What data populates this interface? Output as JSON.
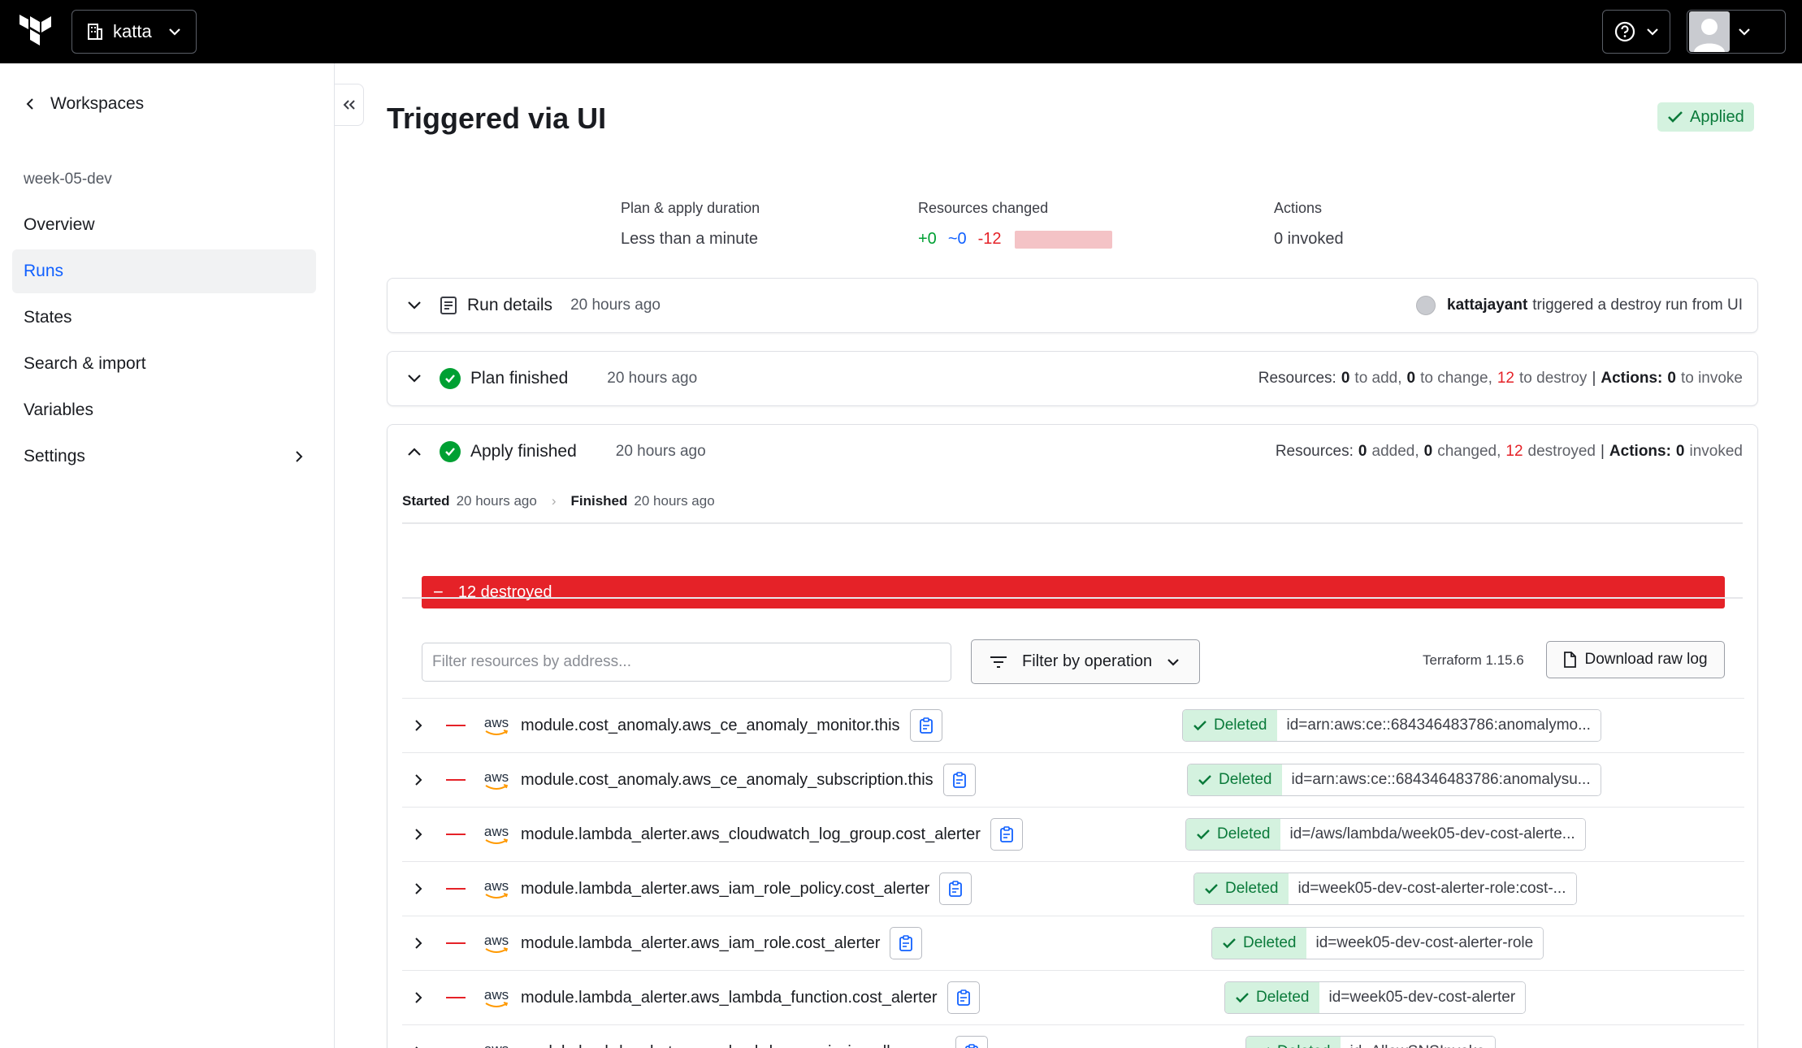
{
  "topbar": {
    "org_name": "katta",
    "logo_icon": "terraform-logo",
    "help_icon": "help-circle-icon",
    "user_icon": "user-avatar"
  },
  "sidebar": {
    "back_label": "Workspaces",
    "workspace_name": "week-05-dev",
    "items": [
      {
        "label": "Overview",
        "active": false
      },
      {
        "label": "Runs",
        "active": true
      },
      {
        "label": "States",
        "active": false
      },
      {
        "label": "Search & import",
        "active": false
      },
      {
        "label": "Variables",
        "active": false
      },
      {
        "label": "Settings",
        "active": false,
        "has_submenu": true
      }
    ]
  },
  "page": {
    "title": "Triggered via UI",
    "status_badge": "Applied"
  },
  "summary": {
    "duration_label": "Plan & apply duration",
    "duration_value": "Less than a minute",
    "resources_label": "Resources changed",
    "added": "+0",
    "changed": "~0",
    "destroyed": "-12",
    "actions_label": "Actions",
    "actions_value": "0 invoked"
  },
  "run_details": {
    "title": "Run details",
    "time": "20 hours ago",
    "user": "kattajayant",
    "description": "triggered a destroy run from UI"
  },
  "plan": {
    "title": "Plan finished",
    "time": "20 hours ago",
    "resources_label": "Resources:",
    "add_count": "0",
    "add_text": "to add,",
    "change_count": "0",
    "change_text": "to change,",
    "destroy_count": "12",
    "destroy_text": "to destroy",
    "sep": "|",
    "actions_label": "Actions:",
    "actions_count": "0",
    "actions_text": "to invoke"
  },
  "apply": {
    "title": "Apply finished",
    "time": "20 hours ago",
    "resources_label": "Resources:",
    "added_count": "0",
    "added_text": "added,",
    "changed_count": "0",
    "changed_text": "changed,",
    "destroyed_count": "12",
    "destroyed_text": "destroyed",
    "sep": "|",
    "actions_label": "Actions:",
    "actions_count": "0",
    "actions_text": "invoked",
    "started_label": "Started",
    "started_time": "20 hours ago",
    "finished_label": "Finished",
    "finished_time": "20 hours ago",
    "destroyed_bar": "12 destroyed",
    "filter_placeholder": "Filter resources by address...",
    "filter_button": "Filter by operation",
    "terraform_version": "Terraform 1.15.6",
    "download_button": "Download raw log",
    "provider_label": "aws",
    "resources": [
      {
        "address": "module.cost_anomaly.aws_ce_anomaly_monitor.this",
        "status": "Deleted",
        "id": "id=arn:aws:ce::684346483786:anomalymo..."
      },
      {
        "address": "module.cost_anomaly.aws_ce_anomaly_subscription.this",
        "status": "Deleted",
        "id": "id=arn:aws:ce::684346483786:anomalysu..."
      },
      {
        "address": "module.lambda_alerter.aws_cloudwatch_log_group.cost_alerter",
        "status": "Deleted",
        "id": "id=/aws/lambda/week05-dev-cost-alerte..."
      },
      {
        "address": "module.lambda_alerter.aws_iam_role_policy.cost_alerter",
        "status": "Deleted",
        "id": "id=week05-dev-cost-alerter-role:cost-..."
      },
      {
        "address": "module.lambda_alerter.aws_iam_role.cost_alerter",
        "status": "Deleted",
        "id": "id=week05-dev-cost-alerter-role"
      },
      {
        "address": "module.lambda_alerter.aws_lambda_function.cost_alerter",
        "status": "Deleted",
        "id": "id=week05-dev-cost-alerter"
      },
      {
        "address": "module.lambda_alerter.aws_lambda_permission.allow_sns",
        "status": "Deleted",
        "id": "id=AllowSNSInvoke"
      }
    ]
  },
  "colors": {
    "accent_blue": "#1060ff",
    "success_green": "#00a033",
    "danger_red": "#e52228",
    "applied_bg": "#d4f2df"
  }
}
